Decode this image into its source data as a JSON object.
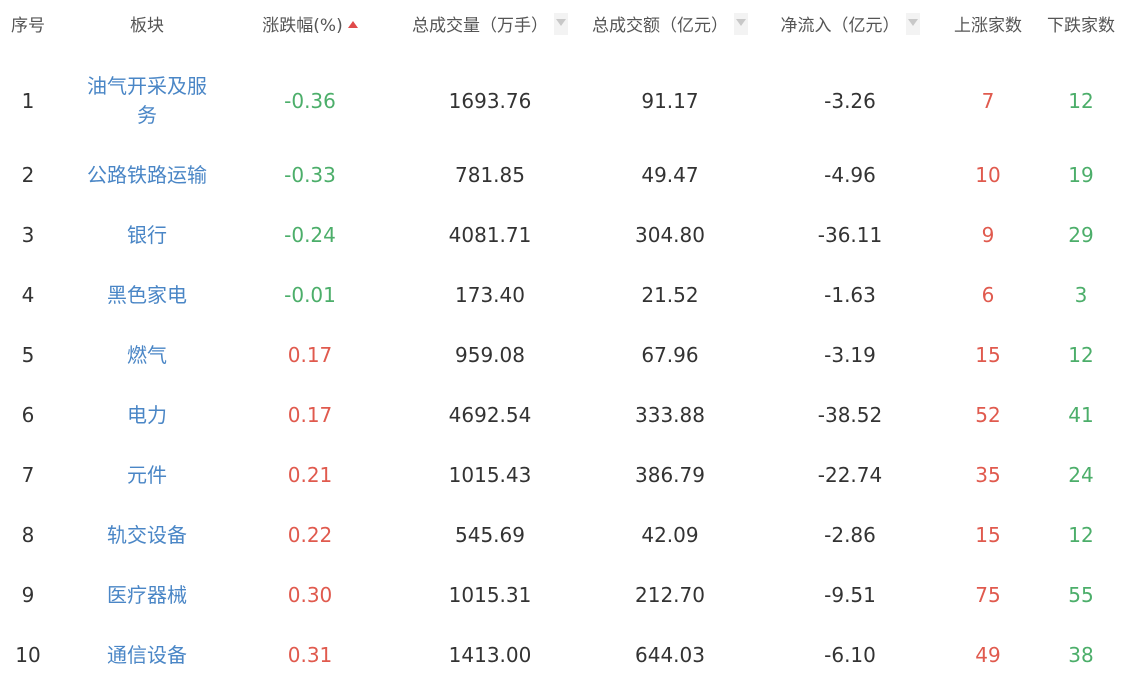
{
  "header": {
    "index": "序号",
    "sector": "板块",
    "change_pct": "涨跌幅(%)",
    "volume": "总成交量（万手）",
    "turnover": "总成交额（亿元）",
    "net_inflow": "净流入（亿元）",
    "up_count": "上涨家数",
    "down_count": "下跌家数"
  },
  "colors": {
    "rise": "#e05a4e",
    "fall": "#4cae6a",
    "link": "#4a86c6"
  },
  "rows": [
    {
      "index": "1",
      "sector": "油气开采及服务",
      "change_pct": "-0.36",
      "volume": "1693.76",
      "turnover": "91.17",
      "net_inflow": "-3.26",
      "up_count": "7",
      "down_count": "12"
    },
    {
      "index": "2",
      "sector": "公路铁路运输",
      "change_pct": "-0.33",
      "volume": "781.85",
      "turnover": "49.47",
      "net_inflow": "-4.96",
      "up_count": "10",
      "down_count": "19"
    },
    {
      "index": "3",
      "sector": "银行",
      "change_pct": "-0.24",
      "volume": "4081.71",
      "turnover": "304.80",
      "net_inflow": "-36.11",
      "up_count": "9",
      "down_count": "29"
    },
    {
      "index": "4",
      "sector": "黑色家电",
      "change_pct": "-0.01",
      "volume": "173.40",
      "turnover": "21.52",
      "net_inflow": "-1.63",
      "up_count": "6",
      "down_count": "3"
    },
    {
      "index": "5",
      "sector": "燃气",
      "change_pct": "0.17",
      "volume": "959.08",
      "turnover": "67.96",
      "net_inflow": "-3.19",
      "up_count": "15",
      "down_count": "12"
    },
    {
      "index": "6",
      "sector": "电力",
      "change_pct": "0.17",
      "volume": "4692.54",
      "turnover": "333.88",
      "net_inflow": "-38.52",
      "up_count": "52",
      "down_count": "41"
    },
    {
      "index": "7",
      "sector": "元件",
      "change_pct": "0.21",
      "volume": "1015.43",
      "turnover": "386.79",
      "net_inflow": "-22.74",
      "up_count": "35",
      "down_count": "24"
    },
    {
      "index": "8",
      "sector": "轨交设备",
      "change_pct": "0.22",
      "volume": "545.69",
      "turnover": "42.09",
      "net_inflow": "-2.86",
      "up_count": "15",
      "down_count": "12"
    },
    {
      "index": "9",
      "sector": "医疗器械",
      "change_pct": "0.30",
      "volume": "1015.31",
      "turnover": "212.70",
      "net_inflow": "-9.51",
      "up_count": "75",
      "down_count": "55"
    },
    {
      "index": "10",
      "sector": "通信设备",
      "change_pct": "0.31",
      "volume": "1413.00",
      "turnover": "644.03",
      "net_inflow": "-6.10",
      "up_count": "49",
      "down_count": "38"
    }
  ]
}
